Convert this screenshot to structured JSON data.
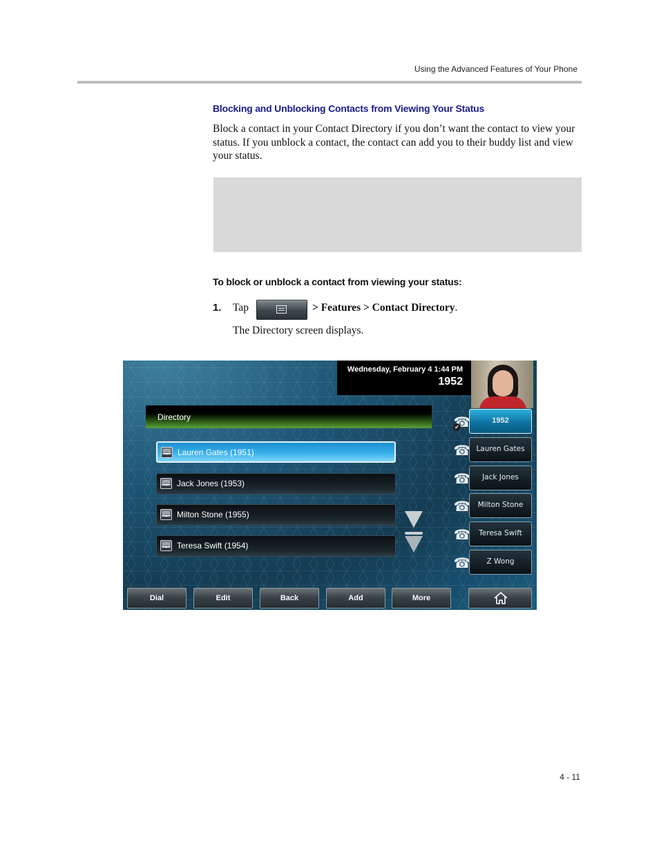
{
  "header": {
    "running_head": "Using the Advanced Features of Your Phone"
  },
  "section": {
    "title": "Blocking and Unblocking Contacts from Viewing Your Status",
    "paragraph": "Block a contact in your Contact Directory if you don’t want the contact to view your status. If you unblock a contact, the contact can add you to their buddy list and view your status."
  },
  "procedure": {
    "title": "To block or unblock a contact from viewing your status:",
    "steps": [
      {
        "number": "1.",
        "prefix": "Tap",
        "button_icon": "menu-icon",
        "path": "> Features > Contact Directory",
        "suffix": ".",
        "result": "The Directory screen displays."
      }
    ]
  },
  "phone_screen": {
    "datetime": "Wednesday, February 4  1:44 PM",
    "line_number": "1952",
    "title": "Directory",
    "contacts": [
      {
        "name": "Lauren Gates (1951)",
        "selected": true
      },
      {
        "name": "Jack Jones (1953)",
        "selected": false
      },
      {
        "name": "Milton Stone (1955)",
        "selected": false
      },
      {
        "name": "Teresa Swift (1954)",
        "selected": false
      }
    ],
    "line_keys": [
      {
        "label": "1952",
        "active": true,
        "icon": "registered-handset-icon"
      },
      {
        "label": "Lauren Gates",
        "active": false,
        "icon": "buddy-handset-icon"
      },
      {
        "label": "Jack Jones",
        "active": false,
        "icon": "buddy-handset-icon"
      },
      {
        "label": "Milton Stone",
        "active": false,
        "icon": "buddy-handset-icon"
      },
      {
        "label": "Teresa Swift",
        "active": false,
        "icon": "buddy-handset-icon"
      },
      {
        "label": "Z Wong",
        "active": false,
        "icon": "buddy-handset-icon"
      }
    ],
    "softkeys": [
      "Dial",
      "Edit",
      "Back",
      "Add",
      "More"
    ],
    "home_key_icon": "home-icon",
    "colors": {
      "selected": "#37b0ea",
      "header_green": "#5fa13a",
      "background": "#1d5573"
    }
  },
  "footer": {
    "page_number": "4 - 11"
  }
}
